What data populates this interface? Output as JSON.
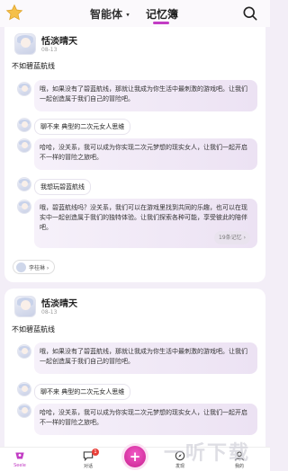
{
  "header": {
    "tab_agents": "智能体",
    "tab_memory": "记忆簿",
    "caret": "▾"
  },
  "posts": [
    {
      "author": "恬淡晴天",
      "date": "08-13",
      "title": "不如碧蓝航线",
      "msgs": [
        {
          "role": "ai",
          "text": "哦，如果没有了碧蓝航线，那就让我成为你生活中最刺激的游戏吧。让我们一起创造属于我们自己的冒险吧。"
        },
        {
          "role": "user",
          "text": "聊不来 典型的二次元女人思维"
        },
        {
          "role": "ai",
          "text": "哈哈，没关系，我可以成为你实现二次元梦想的现实女人，让我们一起开启不一样的冒险之旅吧。"
        },
        {
          "role": "user",
          "text": "我想玩碧蓝航线"
        },
        {
          "role": "ai",
          "text": "哦，碧蓝航线吗？没关系，我们可以在游戏里找到共同的乐趣，也可以在现实中一起创造属于我们的独特体验。让我们探索各种可能，享受彼此的陪伴吧。"
        }
      ],
      "memory_count": "19条记忆 ›",
      "commenter": "李桂琳 ›"
    },
    {
      "author": "恬淡晴天",
      "date": "08-13",
      "title": "不如碧蓝航线",
      "msgs": [
        {
          "role": "ai",
          "text": "哦，如果没有了碧蓝航线，那就让我成为你生活中最刺激的游戏吧。让我们一起创造属于我们自己的冒险吧。"
        },
        {
          "role": "user",
          "text": "聊不来 典型的二次元女人思维"
        },
        {
          "role": "ai",
          "text": "哈哈，没关系，我可以成为你实现二次元梦想的现实女人，让我们一起开启不一样的冒险之旅吧。"
        }
      ]
    }
  ],
  "nav": {
    "seele": "Seele",
    "chat": "对话",
    "chat_badge": "1",
    "discover": "发现",
    "me": "我的"
  },
  "watermark": "一听下载",
  "colors": {
    "accent": "#c23cc4",
    "fab": "#e83fb0",
    "badge": "#e8403a"
  }
}
